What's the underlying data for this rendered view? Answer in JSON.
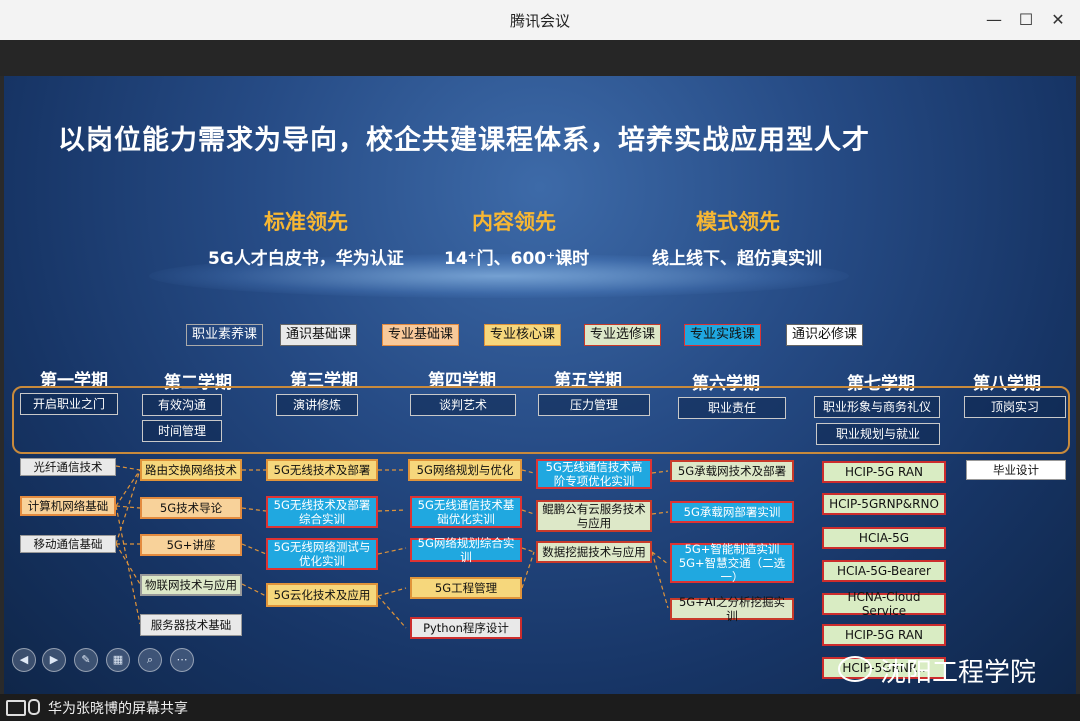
{
  "window": {
    "title": "腾讯会议",
    "minimize_glyph": "—",
    "maximize_glyph": "☐",
    "close_glyph": "✕"
  },
  "slide": {
    "title": "以岗位能力需求为导向，校企共建课程体系，培养实战应用型人才",
    "pillars": [
      {
        "heading": "标准领先",
        "sub": "5G人才白皮书，华为认证"
      },
      {
        "heading": "内容领先",
        "sub": "14⁺门、600⁺课时"
      },
      {
        "heading": "模式领先",
        "sub": "线上线下、超仿真实训"
      }
    ],
    "legend": [
      "职业素养课",
      "通识基础课",
      "专业基础课",
      "专业核心课",
      "专业选修课",
      "专业实践课",
      "通识必修课"
    ],
    "semesters": [
      "第一学期",
      "第二学期",
      "第三学期",
      "第四学期",
      "第五学期",
      "第六学期",
      "第七学期",
      "第八学期"
    ],
    "soft_skills": [
      "开启职业之门",
      "有效沟通",
      "时间管理",
      "演讲修炼",
      "谈判艺术",
      "压力管理",
      "职业责任",
      "职业形象与商务礼仪",
      "职业规划与就业",
      "顶岗实习"
    ],
    "courses": {
      "sem1": [
        "光纤通信技术",
        "计算机网络基础",
        "移动通信基础"
      ],
      "sem2": [
        "路由交换网络技术",
        "5G技术导论",
        "5G+讲座",
        "物联网技术与应用",
        "服务器技术基础"
      ],
      "sem3": [
        "5G无线技术及部署",
        "5G无线技术及部署综合实训",
        "5G无线网络测试与优化实训",
        "5G云化技术及应用"
      ],
      "sem4": [
        "5G网络规划与优化",
        "5G无线通信技术基础优化实训",
        "5G网络规划综合实训",
        "5G工程管理",
        "Python程序设计"
      ],
      "sem5": [
        "5G无线通信技术高阶专项优化实训",
        "鲲鹏公有云服务技术与应用",
        "数据挖掘技术与应用"
      ],
      "sem6": [
        "5G承载网技术及部署",
        "5G承载网部署实训",
        "5G+智能制造实训\n5G+智慧交通（二选一）",
        "5G+AI之分析挖掘实训"
      ],
      "sem7": [
        "HCIP-5G RAN",
        "HCIP-5GRNP&RNO",
        "HCIA-5G",
        "HCIA-5G-Bearer",
        "HCNA-Cloud Service",
        "HCIP-5G RAN",
        "HCIP-5GRNP..."
      ],
      "sem8": [
        "毕业设计"
      ]
    },
    "toolbar_icons": [
      "prev-icon",
      "next-icon",
      "pen-icon",
      "grid-icon",
      "zoom-icon",
      "more-icon"
    ],
    "watermark": "沈阳工程学院"
  },
  "statusbar": {
    "share_text": "华为张晓博的屏幕共享"
  }
}
